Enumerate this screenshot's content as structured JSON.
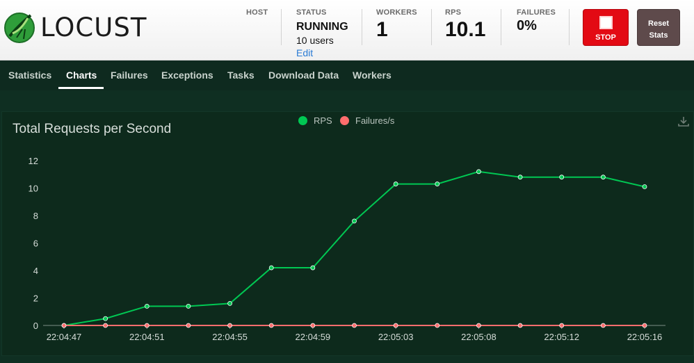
{
  "header": {
    "logo_text": "LOCUST",
    "host": {
      "label": "HOST"
    },
    "status": {
      "label": "STATUS",
      "value": "RUNNING",
      "users": "10 users",
      "edit": "Edit"
    },
    "workers": {
      "label": "WORKERS",
      "value": "1"
    },
    "rps": {
      "label": "RPS",
      "value": "10.1"
    },
    "failures": {
      "label": "FAILURES",
      "value": "0%"
    },
    "stop_label": "STOP",
    "reset_label_1": "Reset",
    "reset_label_2": "Stats"
  },
  "nav": {
    "tabs": [
      "Statistics",
      "Charts",
      "Failures",
      "Exceptions",
      "Tasks",
      "Download Data",
      "Workers"
    ],
    "active": "Charts"
  },
  "colors": {
    "rps": "#00c853",
    "failures": "#ff6d6d",
    "accent_stop": "#e30a14"
  },
  "chart_data": {
    "type": "line",
    "title": "Total Requests per Second",
    "legend": [
      "RPS",
      "Failures/s"
    ],
    "legend_position": "top-center",
    "ylim": [
      0,
      12
    ],
    "y_ticks": [
      "0",
      "2",
      "4",
      "6",
      "8",
      "10",
      "12"
    ],
    "x_tick_labels": [
      "22:04:47",
      "22:04:51",
      "22:04:55",
      "22:04:59",
      "22:05:03",
      "22:05:08",
      "22:05:12",
      "22:05:16"
    ],
    "series": [
      {
        "name": "RPS",
        "values": [
          0,
          0.5,
          1.4,
          1.4,
          1.6,
          4.2,
          4.2,
          7.6,
          10.3,
          10.3,
          11.2,
          10.8,
          10.8,
          10.8,
          10.1
        ]
      },
      {
        "name": "Failures/s",
        "values": [
          0,
          0,
          0,
          0,
          0,
          0,
          0,
          0,
          0,
          0,
          0,
          0,
          0,
          0,
          0
        ]
      }
    ]
  }
}
